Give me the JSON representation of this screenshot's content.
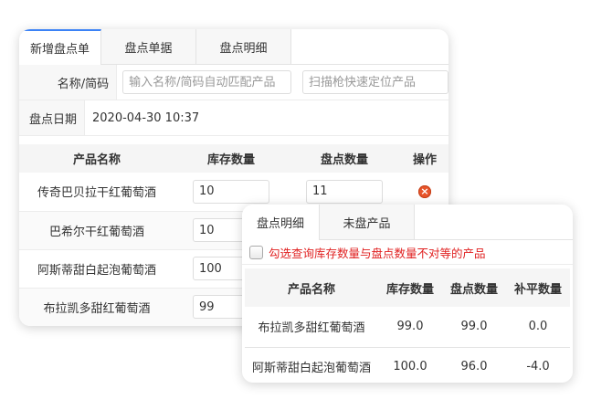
{
  "main": {
    "tabs": [
      "新增盘点单",
      "盘点单据",
      "盘点明细"
    ],
    "name_label": "名称/简码",
    "name_placeholder": "输入名称/简码自动匹配产品",
    "scan_placeholder": "扫描枪快速定位产品",
    "date_label": "盘点日期",
    "date_value": "2020-04-30 10:37",
    "headers": [
      "产品名称",
      "库存数量",
      "盘点数量",
      "操作"
    ],
    "rows": [
      {
        "name": "传奇巴贝拉干红葡萄酒",
        "stock": "10",
        "count": "11"
      },
      {
        "name": "巴希尔干红葡萄酒",
        "stock": "10"
      },
      {
        "name": "阿斯蒂甜白起泡葡萄酒",
        "stock": "100"
      },
      {
        "name": "布拉凯多甜红葡萄酒",
        "stock": "99"
      }
    ]
  },
  "popup": {
    "tabs": [
      "盘点明细",
      "未盘产品"
    ],
    "filter_label": "勾选查询库存数量与盘点数量不对等的产品",
    "headers": [
      "产品名称",
      "库存数量",
      "盘点数量",
      "补平数量"
    ],
    "rows": [
      {
        "name": "布拉凯多甜红葡萄酒",
        "stock": "99.0",
        "count": "99.0",
        "diff": "0.0"
      },
      {
        "name": "阿斯蒂甜白起泡葡萄酒",
        "stock": "100.0",
        "count": "96.0",
        "diff": "-4.0"
      }
    ]
  },
  "colors": {
    "accent": "#3b82f6",
    "warning_text": "#e02020",
    "delete_icon": "#e8542a"
  },
  "icons": {
    "delete": "close-circle-icon"
  }
}
